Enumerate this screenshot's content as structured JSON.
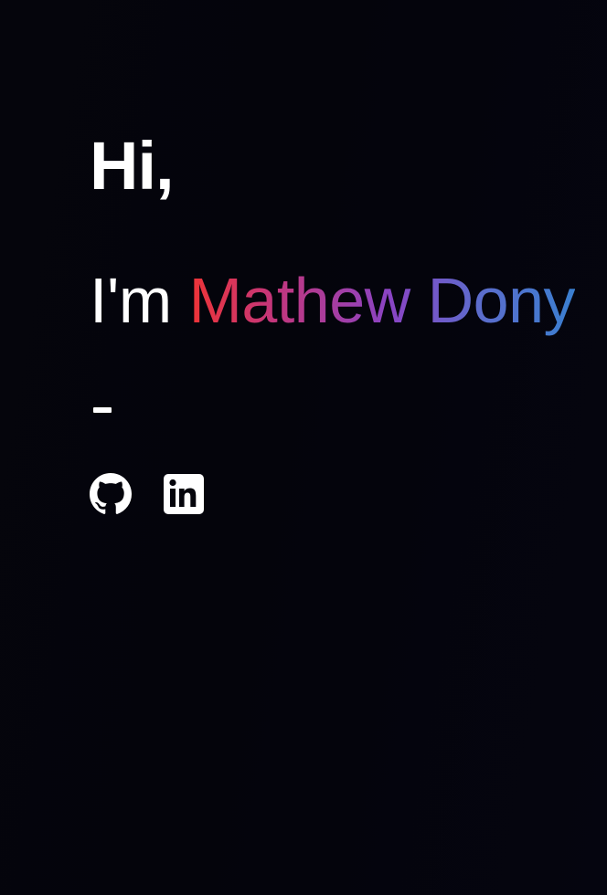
{
  "hero": {
    "greeting": "Hi,",
    "intro_prefix": "I'm",
    "name": "Mathew Dony",
    "separator": "-"
  },
  "socials": [
    {
      "icon": "github-icon",
      "label": "GitHub"
    },
    {
      "icon": "linkedin-icon",
      "label": "LinkedIn"
    }
  ],
  "colors": {
    "background": "#05050c",
    "text": "#ffffff",
    "name_gradient": [
      "#ef3436",
      "#c3367c",
      "#8a44c4",
      "#5c6ccc",
      "#3a7fd0"
    ]
  }
}
